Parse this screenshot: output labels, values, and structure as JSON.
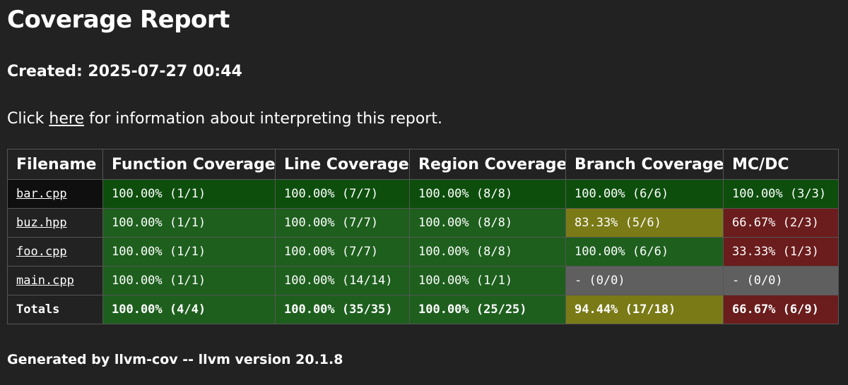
{
  "page": {
    "title": "Coverage Report",
    "created": "Created: 2025-07-27 00:44",
    "info_prefix": "Click ",
    "info_link": "here",
    "info_suffix": " for information about interpreting this report.",
    "footer": "Generated by llvm-cov -- llvm version 20.1.8"
  },
  "colors": {
    "full_dark": "#0d4e0d",
    "full": "#1e5f1e",
    "partial": "#7a7a17",
    "low": "#6b1c1c",
    "none": "#5f5f5f"
  },
  "table": {
    "headers": [
      "Filename",
      "Function Coverage",
      "Line Coverage",
      "Region Coverage",
      "Branch Coverage",
      "MC/DC"
    ],
    "rows": [
      {
        "file": "bar.cpp",
        "cells": [
          {
            "text": "100.00% (1/1)",
            "status": "full_dark"
          },
          {
            "text": "100.00% (7/7)",
            "status": "full_dark"
          },
          {
            "text": "100.00% (8/8)",
            "status": "full_dark"
          },
          {
            "text": "100.00% (6/6)",
            "status": "full_dark"
          },
          {
            "text": "100.00% (3/3)",
            "status": "full_dark"
          }
        ]
      },
      {
        "file": "buz.hpp",
        "cells": [
          {
            "text": "100.00% (1/1)",
            "status": "full"
          },
          {
            "text": "100.00% (7/7)",
            "status": "full"
          },
          {
            "text": "100.00% (8/8)",
            "status": "full"
          },
          {
            "text": "83.33% (5/6)",
            "status": "partial"
          },
          {
            "text": "66.67% (2/3)",
            "status": "low"
          }
        ]
      },
      {
        "file": "foo.cpp",
        "cells": [
          {
            "text": "100.00% (1/1)",
            "status": "full"
          },
          {
            "text": "100.00% (7/7)",
            "status": "full"
          },
          {
            "text": "100.00% (8/8)",
            "status": "full"
          },
          {
            "text": "100.00% (6/6)",
            "status": "full"
          },
          {
            "text": "33.33% (1/3)",
            "status": "low"
          }
        ]
      },
      {
        "file": "main.cpp",
        "cells": [
          {
            "text": "100.00% (1/1)",
            "status": "full"
          },
          {
            "text": "100.00% (14/14)",
            "status": "full"
          },
          {
            "text": "100.00% (1/1)",
            "status": "full"
          },
          {
            "text": "- (0/0)",
            "status": "none"
          },
          {
            "text": "- (0/0)",
            "status": "none"
          }
        ]
      }
    ],
    "totals": {
      "label": "Totals",
      "cells": [
        {
          "text": "100.00% (4/4)",
          "status": "full"
        },
        {
          "text": "100.00% (35/35)",
          "status": "full"
        },
        {
          "text": "100.00% (25/25)",
          "status": "full"
        },
        {
          "text": "94.44% (17/18)",
          "status": "partial"
        },
        {
          "text": "66.67% (6/9)",
          "status": "low"
        }
      ]
    }
  }
}
